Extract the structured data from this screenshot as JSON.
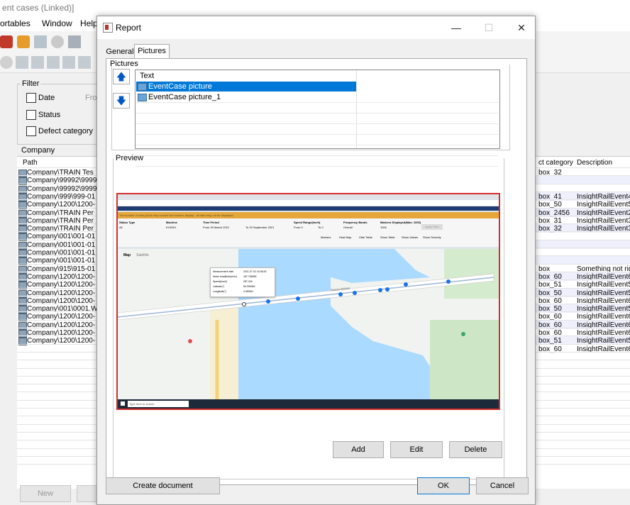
{
  "background": {
    "window_title": "ent cases (Linked)]",
    "menu": [
      "ortables",
      "Window",
      "Help"
    ],
    "filter": {
      "title": "Filter",
      "date_label": "Date",
      "from_label": "Fro",
      "status_label": "Status",
      "defect_label": "Defect category"
    },
    "company": {
      "title": "Company",
      "path_header": "Path",
      "paths": [
        "Company\\TRAIN Tes",
        "Company\\99992\\9999",
        "Company\\99992\\9999",
        "Company\\999\\999-01",
        "Company\\1200\\1200-",
        "Company\\TRAIN Per",
        "Company\\TRAIN Per",
        "Company\\TRAIN Per",
        "Company\\001\\001-01",
        "Company\\001\\001-01",
        "Company\\001\\001-01",
        "Company\\001\\001-01",
        "Company\\915\\915-01",
        "Company\\1200\\1200-",
        "Company\\1200\\1200-",
        "Company\\1200\\1200-",
        "Company\\1200\\1200-",
        "Company\\001\\0001.W",
        "Company\\1200\\1200-",
        "Company\\1200\\1200-",
        "Company\\1200\\1200-",
        "Company\\1200\\1200-"
      ],
      "right_headers": [
        "ct category",
        "Description"
      ],
      "right_rows": [
        [
          "box_32",
          ""
        ],
        [
          "",
          ""
        ],
        [
          "",
          ""
        ],
        [
          "box_41",
          "InsightRailEvent4"
        ],
        [
          "box_50",
          "InsightRailEvent5"
        ],
        [
          "box_2456",
          "InsightRailEvent2"
        ],
        [
          "box_31",
          "InsightRailEvent3"
        ],
        [
          "box_32",
          "InsightRailEvent3"
        ],
        [
          "",
          ""
        ],
        [
          "",
          ""
        ],
        [
          "",
          ""
        ],
        [
          "",
          ""
        ],
        [
          "box",
          "Something not righ"
        ],
        [
          "box_60",
          "InsightRailEvent6"
        ],
        [
          "box_51",
          "InsightRailEvent5"
        ],
        [
          "box_50",
          "InsightRailEvent5"
        ],
        [
          "box_60",
          "InsightRailEvent6"
        ],
        [
          "box_50",
          "InsightRailEvent5"
        ],
        [
          "box_60",
          "InsightRailEvent6"
        ],
        [
          "box_60",
          "InsightRailEvent6"
        ],
        [
          "box_60",
          "InsightRailEvent6"
        ],
        [
          "box_51",
          "InsightRailEvent5"
        ],
        [
          "box_60",
          "InsightRailEvent6"
        ]
      ]
    },
    "new_button": "New"
  },
  "dialog": {
    "title": "Report",
    "minimize_glyph": "—",
    "maximize_glyph": "☐",
    "close_glyph": "✕",
    "tabs": [
      "General",
      "Pictures"
    ],
    "active_tab": "Pictures",
    "pictures_group": "Pictures",
    "up_glyph": "🡅",
    "down_glyph": "🡇",
    "list_header": "Text",
    "items": [
      "EventCase picture",
      "EventCase picture_1"
    ],
    "selected_item": "EventCase picture",
    "preview_group": "Preview",
    "buttons": {
      "add": "Add",
      "edit": "Edit",
      "delete": "Delete"
    },
    "create_document": "Create document",
    "ok": "OK",
    "cancel": "Cancel"
  },
  "preview_image": {
    "warning": "The number of data points may exceed the markers display - all data may not be displayed.",
    "filters": [
      "Status Type",
      "Machine",
      "Time Period",
      "Speed Range(km/h)",
      "Frequency Bands",
      "Markers Displayed(Max: 1000)"
    ],
    "values": [
      "All",
      "KV4501",
      "From 29 March 2021",
      "To 29 September 2021",
      "From 0",
      "To 0",
      "Overall",
      "1000"
    ],
    "apply_filter": "Apply Filter",
    "toggles": [
      "Markers",
      "Heat Map",
      "Hide Table",
      "Show Table",
      "Show Values",
      "Show Severity"
    ],
    "map_tabs": [
      "Map",
      "Satellite"
    ],
    "popup": [
      [
        "Measurement date",
        "2021-07-02 15:36:15"
      ],
      [
        "Noise amplitude(m/s²)",
        "187.756959"
      ],
      [
        "Speed(km/h)",
        "287.430"
      ],
      [
        "Latitude(°)",
        "59.336454"
      ],
      [
        "Longitude(°)",
        "4.983611"
      ]
    ],
    "street": "Deutzer Brücke",
    "taskbar_search": "Type here to search",
    "colors": {
      "water": "#aadaff",
      "marker": "#1a73e8",
      "warning_bar": "#e6a73a"
    }
  }
}
